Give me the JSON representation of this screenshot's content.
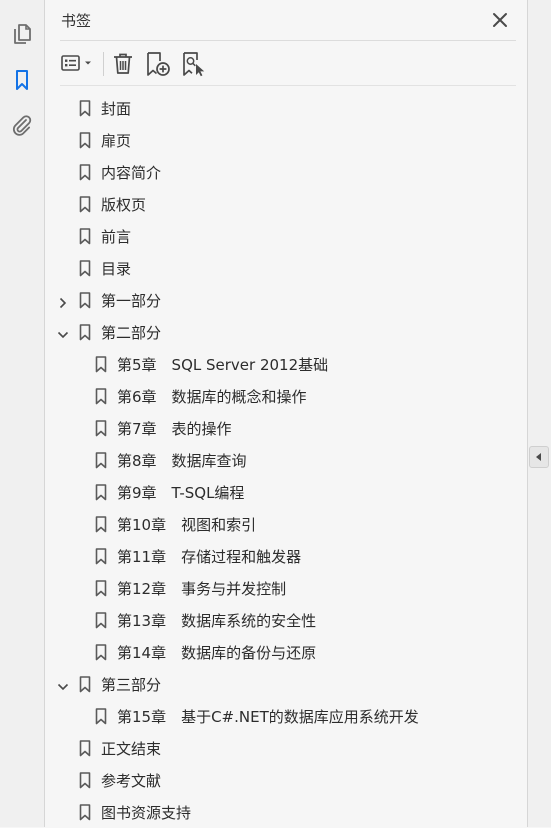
{
  "panel": {
    "title": "书签",
    "close_icon": "close-icon",
    "toolbar": [
      {
        "name": "options-menu-button",
        "icon": "options-list-icon"
      },
      {
        "name": "delete-bookmark-button",
        "icon": "trash-icon"
      },
      {
        "name": "new-bookmark-button",
        "icon": "bookmark-add-icon"
      },
      {
        "name": "new-bookmark-from-selection-button",
        "icon": "bookmark-search-icon"
      }
    ]
  },
  "left_rail": {
    "items": [
      {
        "name": "pages-panel-button",
        "icon": "copy-pages-icon",
        "active": false
      },
      {
        "name": "bookmarks-panel-button",
        "icon": "bookmark-icon",
        "active": true
      },
      {
        "name": "attachments-panel-button",
        "icon": "paperclip-icon",
        "active": false
      }
    ]
  },
  "colors": {
    "accent": "#1473e6",
    "icon": "#6e6e6e",
    "text": "#2c2c2c"
  },
  "bookmarks": [
    {
      "label": "封面",
      "level": 0,
      "expander": "none"
    },
    {
      "label": "扉页",
      "level": 0,
      "expander": "none"
    },
    {
      "label": "内容简介",
      "level": 0,
      "expander": "none"
    },
    {
      "label": "版权页",
      "level": 0,
      "expander": "none"
    },
    {
      "label": "前言",
      "level": 0,
      "expander": "none"
    },
    {
      "label": "目录",
      "level": 0,
      "expander": "none"
    },
    {
      "label": "第一部分",
      "level": 0,
      "expander": "collapsed"
    },
    {
      "label": "第二部分",
      "level": 0,
      "expander": "expanded"
    },
    {
      "label": "第5章　SQL Server 2012基础",
      "level": 1,
      "expander": "none"
    },
    {
      "label": "第6章　数据库的概念和操作",
      "level": 1,
      "expander": "none"
    },
    {
      "label": "第7章　表的操作",
      "level": 1,
      "expander": "none"
    },
    {
      "label": "第8章　数据库查询",
      "level": 1,
      "expander": "none"
    },
    {
      "label": "第9章　T-SQL编程",
      "level": 1,
      "expander": "none"
    },
    {
      "label": "第10章　视图和索引",
      "level": 1,
      "expander": "none"
    },
    {
      "label": "第11章　存储过程和触发器",
      "level": 1,
      "expander": "none"
    },
    {
      "label": "第12章　事务与并发控制",
      "level": 1,
      "expander": "none"
    },
    {
      "label": "第13章　数据库系统的安全性",
      "level": 1,
      "expander": "none"
    },
    {
      "label": "第14章　数据库的备份与还原",
      "level": 1,
      "expander": "none"
    },
    {
      "label": "第三部分",
      "level": 0,
      "expander": "expanded"
    },
    {
      "label": "第15章　基于C#.NET的数据库应用系统开发",
      "level": 1,
      "expander": "none"
    },
    {
      "label": "正文结束",
      "level": 0,
      "expander": "none"
    },
    {
      "label": "参考文献",
      "level": 0,
      "expander": "none"
    },
    {
      "label": "图书资源支持",
      "level": 0,
      "expander": "none"
    }
  ]
}
